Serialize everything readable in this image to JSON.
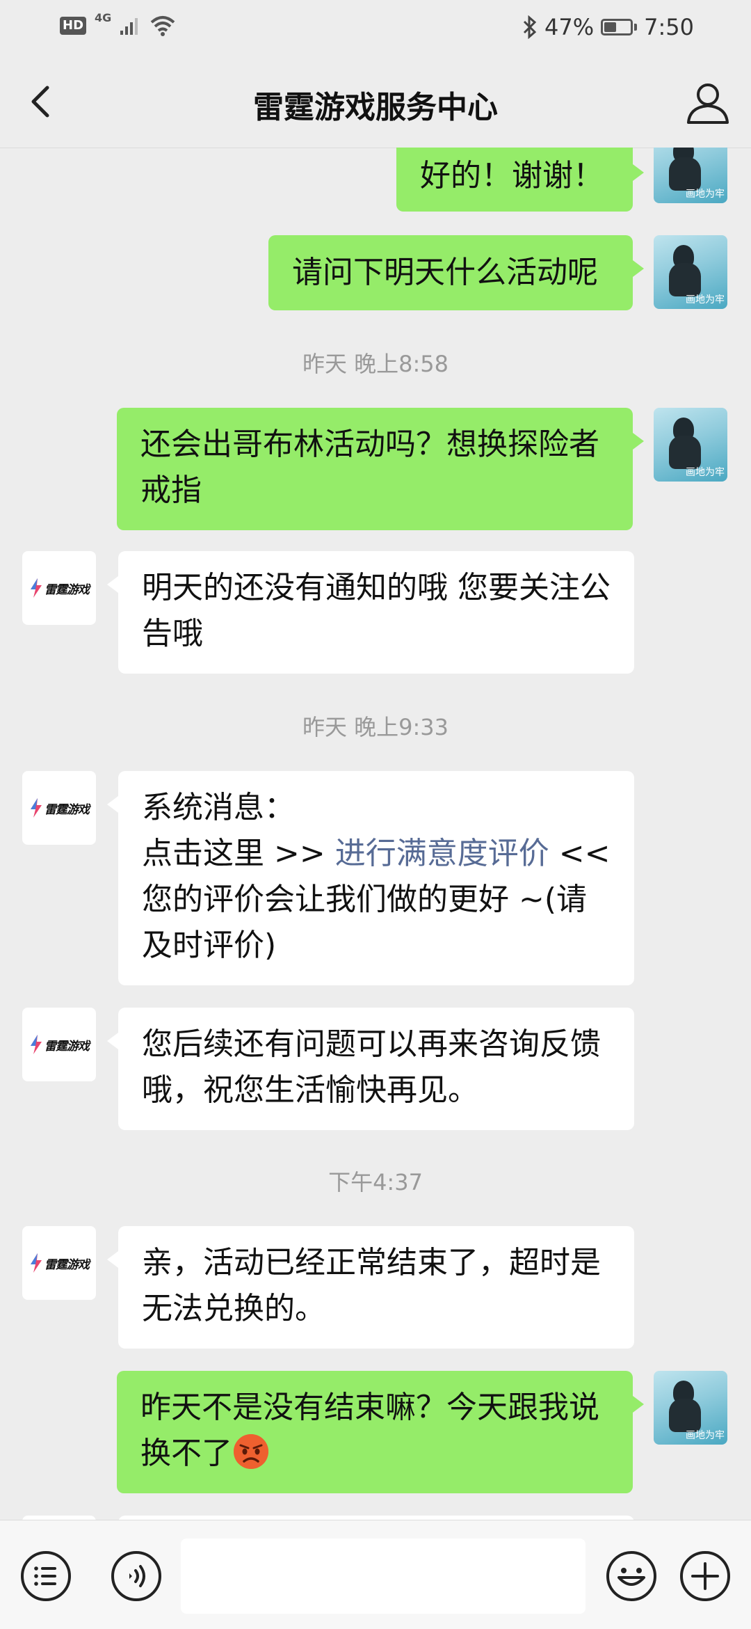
{
  "status_bar": {
    "hd": "HD",
    "network": "4G",
    "battery_percent": "47%",
    "battery_level": 0.47,
    "time": "7:50",
    "icons": [
      "signal-icon",
      "wifi-icon",
      "bluetooth-icon",
      "battery-icon"
    ]
  },
  "header": {
    "title": "雷霆游戏服务中心",
    "back_icon": "chevron-left-icon",
    "profile_icon": "user-icon"
  },
  "avatars": {
    "me_watermark": "画地为牢",
    "service_logo_text": "雷霆游戏"
  },
  "messages": [
    {
      "type": "out",
      "text": "好的！谢谢！"
    },
    {
      "type": "out",
      "text": "请问下明天什么活动呢"
    },
    {
      "type": "time",
      "text": "昨天 晚上8:58"
    },
    {
      "type": "out",
      "text": "还会出哥布林活动吗？想换探险者戒指"
    },
    {
      "type": "in",
      "text": "明天的还没有通知的哦  您要关注公告哦"
    },
    {
      "type": "time",
      "text": "昨天 晚上9:33"
    },
    {
      "type": "in",
      "prefix": "系统消息：",
      "line2_start": "点击这里 >> ",
      "link": "进行满意度评价",
      "suffix": " << 您的评价会让我们做的更好 ~(请及时评价)"
    },
    {
      "type": "in",
      "text": "您后续还有问题可以再来咨询反馈哦，祝您生活愉快再见。"
    },
    {
      "type": "time",
      "text": "下午4:37"
    },
    {
      "type": "in",
      "text": "亲，活动已经正常结束了，超时是无法兑换的。"
    },
    {
      "type": "out",
      "text": "昨天不是没有结束嘛？今天跟我说换不了",
      "emoji": "angry-face-emoji"
    }
  ],
  "input_bar": {
    "left_icons": [
      "list-icon",
      "voice-icon"
    ],
    "right_icons": [
      "smiley-icon",
      "plus-icon"
    ],
    "input_value": ""
  },
  "colors": {
    "background": "#ededed",
    "outgoing_bubble": "#95ec69",
    "incoming_bubble": "#ffffff",
    "link": "#576b95",
    "timestamp": "#999999"
  }
}
